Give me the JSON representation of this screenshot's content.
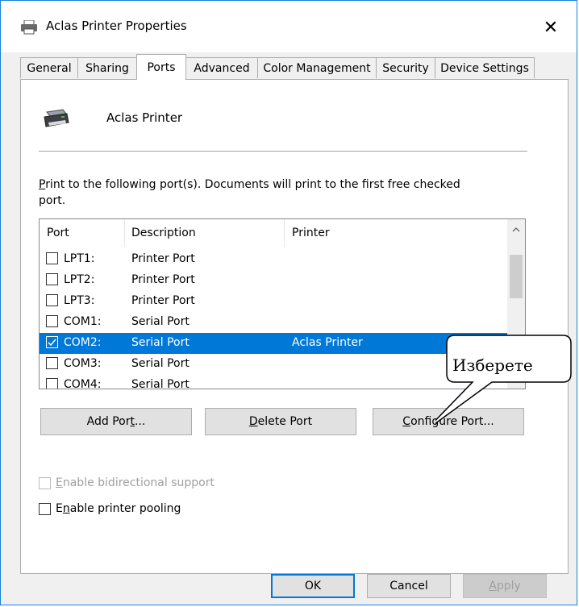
{
  "window": {
    "title": "Aclas Printer Properties",
    "close_label": "✕"
  },
  "tabs": [
    "General",
    "Sharing",
    "Ports",
    "Advanced",
    "Color Management",
    "Security",
    "Device Settings"
  ],
  "active_tab": "Ports",
  "printer": {
    "name": "Aclas Printer"
  },
  "instructions": {
    "hotkey": "P",
    "rest": "rint to the following port(s). Documents will print to the first free checked port."
  },
  "ports_table": {
    "columns": [
      "Port",
      "Description",
      "Printer"
    ],
    "rows": [
      {
        "port": "LPT1:",
        "description": "Printer Port",
        "printer": "",
        "checked": false,
        "selected": false
      },
      {
        "port": "LPT2:",
        "description": "Printer Port",
        "printer": "",
        "checked": false,
        "selected": false
      },
      {
        "port": "LPT3:",
        "description": "Printer Port",
        "printer": "",
        "checked": false,
        "selected": false
      },
      {
        "port": "COM1:",
        "description": "Serial Port",
        "printer": "",
        "checked": false,
        "selected": false
      },
      {
        "port": "COM2:",
        "description": "Serial Port",
        "printer": "Aclas Printer",
        "checked": true,
        "selected": true
      },
      {
        "port": "COM3:",
        "description": "Serial Port",
        "printer": "",
        "checked": false,
        "selected": false
      },
      {
        "port": "COM4:",
        "description": "Serial Port",
        "printer": "",
        "checked": false,
        "selected": false
      }
    ]
  },
  "buttons": {
    "add_port": {
      "pre": "Add Por",
      "hotkey": "t",
      "post": "..."
    },
    "delete_port": {
      "pre": "",
      "hotkey": "D",
      "post": "elete Port"
    },
    "configure_port": {
      "pre": "",
      "hotkey": "C",
      "post": "onfigure Port..."
    },
    "ok": "OK",
    "cancel": "Cancel",
    "apply": {
      "pre": "",
      "hotkey": "A",
      "post": "pply"
    }
  },
  "options": {
    "bidirectional": {
      "pre": "",
      "hotkey": "E",
      "post": "nable bidirectional support",
      "checked": false,
      "enabled": false
    },
    "pooling": {
      "pre": "E",
      "hotkey": "n",
      "post": "able printer pooling",
      "checked": false,
      "enabled": true
    }
  },
  "callout": {
    "text": "Изберете"
  },
  "colors": {
    "accent": "#0078d7",
    "selection": "#0078d7",
    "window_border": "#1883d7"
  },
  "icons": {
    "title": "printer-icon",
    "close": "close-icon",
    "printer": "printer-icon",
    "scroll_up": "chevron-up-icon",
    "scroll_down": "chevron-down-icon",
    "check": "checkmark-icon"
  }
}
